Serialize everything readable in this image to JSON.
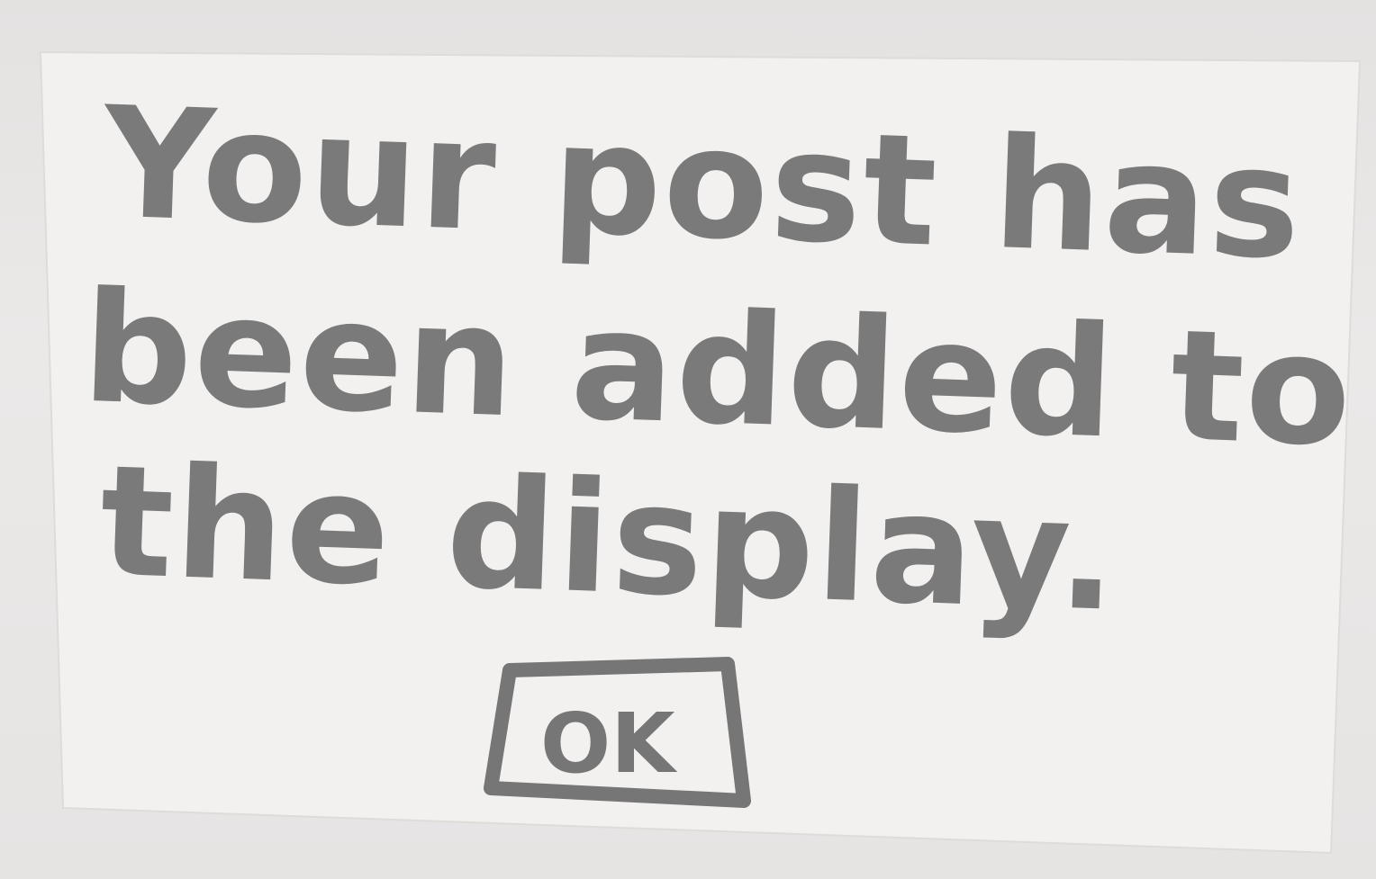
{
  "dialog": {
    "message_lines": [
      "Your post has",
      "been added to",
      "the display."
    ],
    "ok_label": "OK"
  },
  "colors": {
    "ink": "#7a7a7a",
    "paper": "#f2f0ef",
    "background": "#e9e7e6"
  }
}
